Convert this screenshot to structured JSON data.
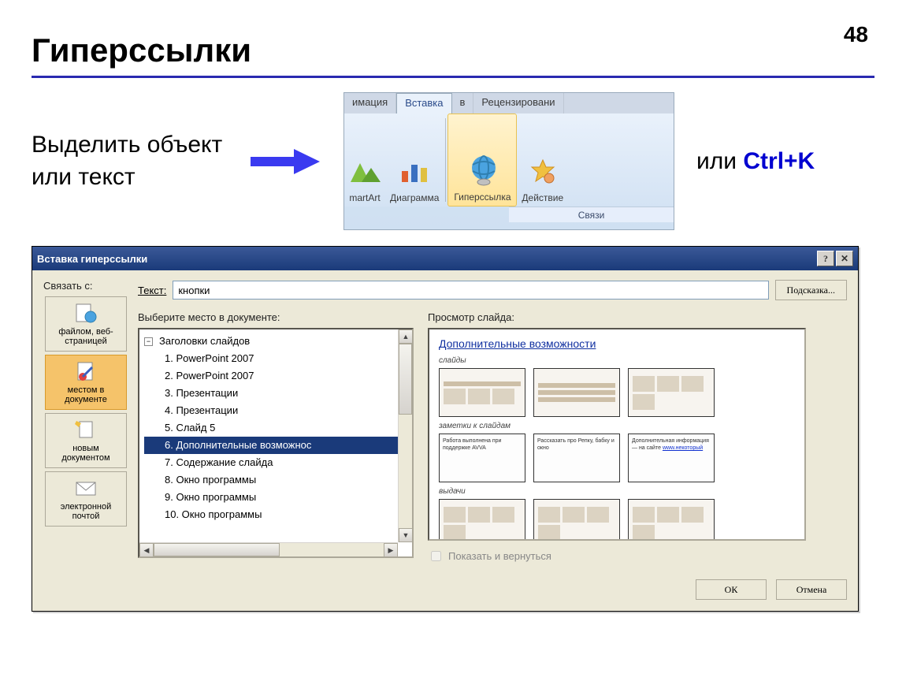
{
  "page_number": "48",
  "title": "Гиперссылки",
  "instruction": "Выделить объект или текст",
  "or_text": "или ",
  "shortcut": "Ctrl+K",
  "ribbon": {
    "tabs": [
      "имация",
      "Вставка",
      "в",
      "Рецензировани"
    ],
    "active_index": 1,
    "buttons": [
      {
        "label": "martArt",
        "icon": "smartart-icon"
      },
      {
        "label": "Диаграмма",
        "icon": "chart-icon"
      },
      {
        "label": "Гиперссылка",
        "icon": "hyperlink-globe-icon",
        "selected": true
      },
      {
        "label": "Действие",
        "icon": "action-icon"
      }
    ],
    "group_label": "Связи"
  },
  "dialog": {
    "title": "Вставка гиперссылки",
    "link_with_label": "Связать с:",
    "text_label": "Текст:",
    "text_value": "кнопки",
    "hint_button": "Подсказка...",
    "side_buttons": [
      {
        "label": "файлом, веб-страницей",
        "icon": "file-web-icon"
      },
      {
        "label": "местом в документе",
        "icon": "place-in-doc-icon",
        "selected": true
      },
      {
        "label": "новым документом",
        "icon": "new-doc-icon"
      },
      {
        "label": "электронной почтой",
        "icon": "email-icon"
      }
    ],
    "tree_label": "Выберите место в документе:",
    "tree_root": "Заголовки слайдов",
    "tree_items": [
      "1. PowerPoint 2007",
      "2. PowerPoint 2007",
      "3. Презентации",
      "4. Презентации",
      "5. Слайд 5",
      "6. Дополнительные возможнос",
      "7. Содержание слайда",
      "8. Окно программы",
      "9. Окно программы",
      "10. Окно программы"
    ],
    "selected_tree_index": 5,
    "preview_label": "Просмотр слайда:",
    "preview_title": "Дополнительные возможности",
    "preview_sec1": "слайды",
    "preview_sec2": "заметки к слайдам",
    "preview_sec3": "выдачи",
    "preview_note1": "Работа выполнена при поддержке AVVA",
    "preview_note2": "Рассказать про Репку, бабку и окно",
    "preview_note3": "Дополнительная информация — на сайте",
    "preview_link": "www.некоторый",
    "show_return": "Показать и вернуться",
    "ok": "ОК",
    "cancel": "Отмена"
  }
}
